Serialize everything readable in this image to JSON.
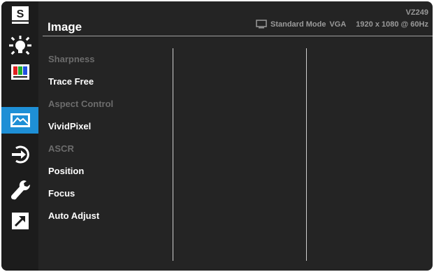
{
  "header": {
    "title": "Image",
    "model": "VZ249",
    "mode": "Standard Mode",
    "input": "VGA",
    "resolution": "1920 x 1080 @ 60Hz"
  },
  "sidebar": {
    "items": [
      {
        "icon": "splendid-icon",
        "label": "S",
        "active": false
      },
      {
        "icon": "brightness-icon",
        "active": false
      },
      {
        "icon": "color-bars-icon",
        "active": false
      },
      {
        "icon": "image-icon",
        "active": true
      },
      {
        "icon": "input-select-icon",
        "active": false
      },
      {
        "icon": "wrench-icon",
        "active": false
      },
      {
        "icon": "shortcut-arrow-icon",
        "active": false
      }
    ]
  },
  "menu": {
    "items": [
      {
        "label": "Sharpness",
        "enabled": false
      },
      {
        "label": "Trace Free",
        "enabled": true
      },
      {
        "label": "Aspect Control",
        "enabled": false
      },
      {
        "label": "VividPixel",
        "enabled": true
      },
      {
        "label": "ASCR",
        "enabled": false
      },
      {
        "label": "Position",
        "enabled": true
      },
      {
        "label": "Focus",
        "enabled": true
      },
      {
        "label": "Auto Adjust",
        "enabled": true
      }
    ]
  },
  "colors": {
    "background": "#242424",
    "accent": "#1e8fd6",
    "text": "#ffffff",
    "disabled_text": "#6c6c6c"
  }
}
